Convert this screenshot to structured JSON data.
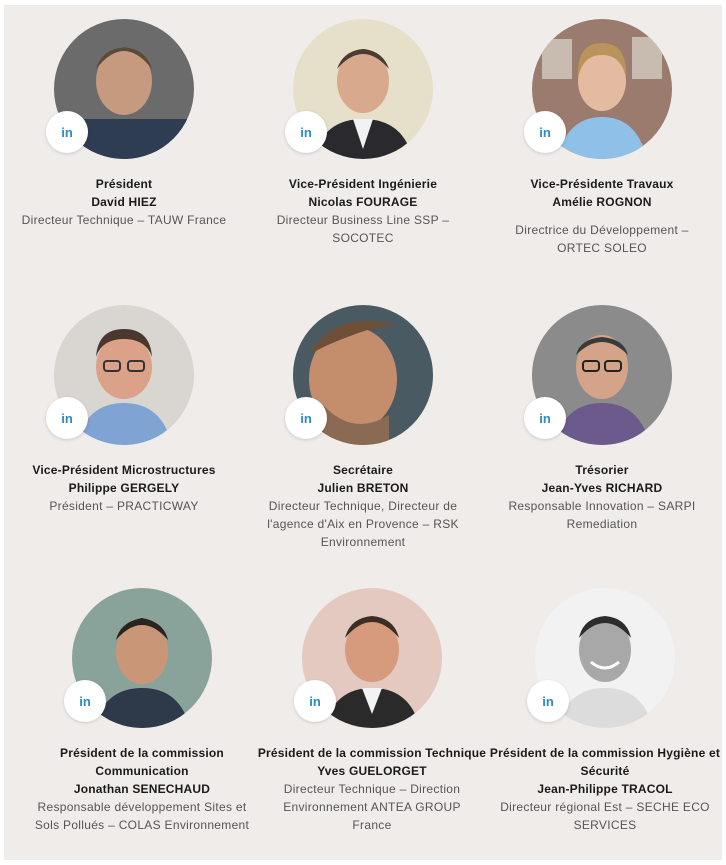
{
  "colors": {
    "background": "#efecea",
    "linkedin": "#2b8bc7",
    "text": "#1a1a1a",
    "muted": "#555555"
  },
  "members": [
    {
      "role": "Président",
      "name": "David HIEZ",
      "description": "Directeur Technique – TAUW France",
      "linkedin": "in",
      "photo": "avatar-photo"
    },
    {
      "role": "Vice-Président Ingénierie",
      "name": "Nicolas FOURAGE",
      "description": "Directeur Business Line SSP – SOCOTEC",
      "linkedin": "in",
      "photo": "avatar-photo"
    },
    {
      "role": "Vice-Présidente Travaux",
      "name": "Amélie ROGNON",
      "description": "Directrice du Développement – ORTEC SOLEO",
      "linkedin": "in",
      "photo": "avatar-photo"
    },
    {
      "role": "Vice-Président Microstructures",
      "name": "Philippe GERGELY",
      "description": "Président – PRACTICWAY",
      "linkedin": "in",
      "photo": "avatar-photo"
    },
    {
      "role": "Secrétaire",
      "name": "Julien BRETON",
      "description": "Directeur Technique, Directeur de l'agence d'Aix en Provence – RSK Environnement",
      "linkedin": "in",
      "photo": "avatar-photo"
    },
    {
      "role": "Trésorier",
      "name": "Jean-Yves RICHARD",
      "description": "Responsable Innovation – SARPI Remediation",
      "linkedin": "in",
      "photo": "avatar-photo"
    },
    {
      "role": "Président de la commission Communication",
      "name": "Jonathan SENECHAUD",
      "description": "Responsable développement Sites et Sols Pollués – COLAS Environnement",
      "linkedin": "in",
      "photo": "avatar-photo"
    },
    {
      "role": "Président de la commission Technique",
      "name": "Yves GUELORGET",
      "description": "Directeur Technique – Direction Environnement ANTEA GROUP France",
      "linkedin": "in",
      "photo": "avatar-photo"
    },
    {
      "role": "Président de la commission Hygiène et Sécurité",
      "name": "Jean-Philippe TRACOL",
      "description": "Directeur régional Est – SECHE ECO SERVICES",
      "linkedin": "in",
      "photo": "avatar-photo"
    }
  ]
}
